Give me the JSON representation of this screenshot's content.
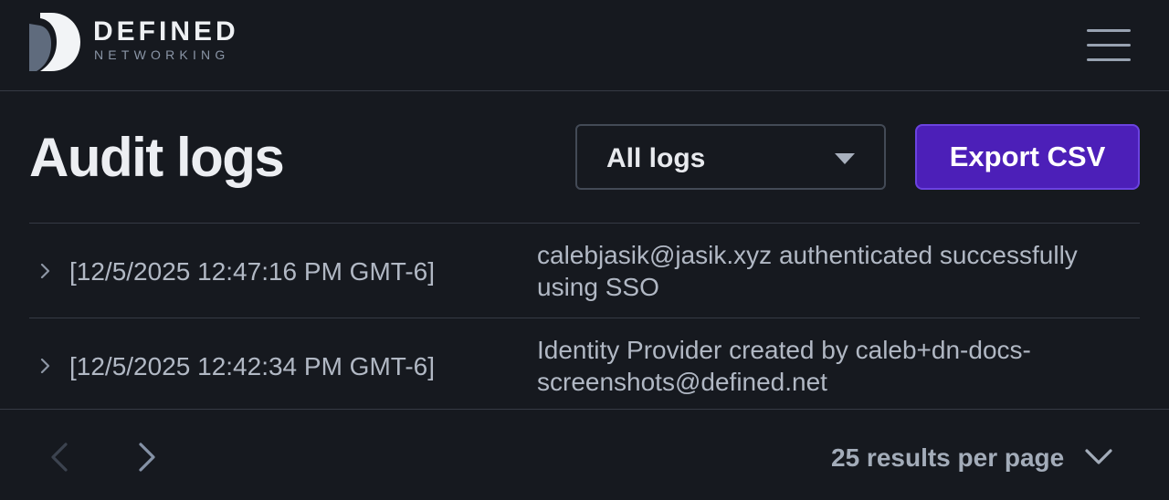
{
  "brand": {
    "name": "DEFINED",
    "subname": "NETWORKING",
    "colors": {
      "mark_dark": "#5f6b7d",
      "mark_light": "#f2f4f6"
    }
  },
  "header": {
    "menu_icon": "hamburger-menu-icon"
  },
  "page": {
    "title": "Audit logs"
  },
  "filter": {
    "selected": "All logs",
    "icon": "caret-down-icon"
  },
  "actions": {
    "export_label": "Export CSV",
    "accent": "#4c1fb8"
  },
  "logs": [
    {
      "timestamp": "[12/5/2025 12:47:16 PM GMT-6]",
      "message": "calebjasik@jasik.xyz authenticated successfully using SSO"
    },
    {
      "timestamp": "[12/5/2025 12:42:34 PM GMT-6]",
      "message": "Identity Provider created by caleb+dn-docs-screenshots@defined.net"
    }
  ],
  "pagination": {
    "per_page_label": "25 results per page",
    "prev_icon": "chevron-left-icon",
    "next_icon": "chevron-right-icon"
  }
}
